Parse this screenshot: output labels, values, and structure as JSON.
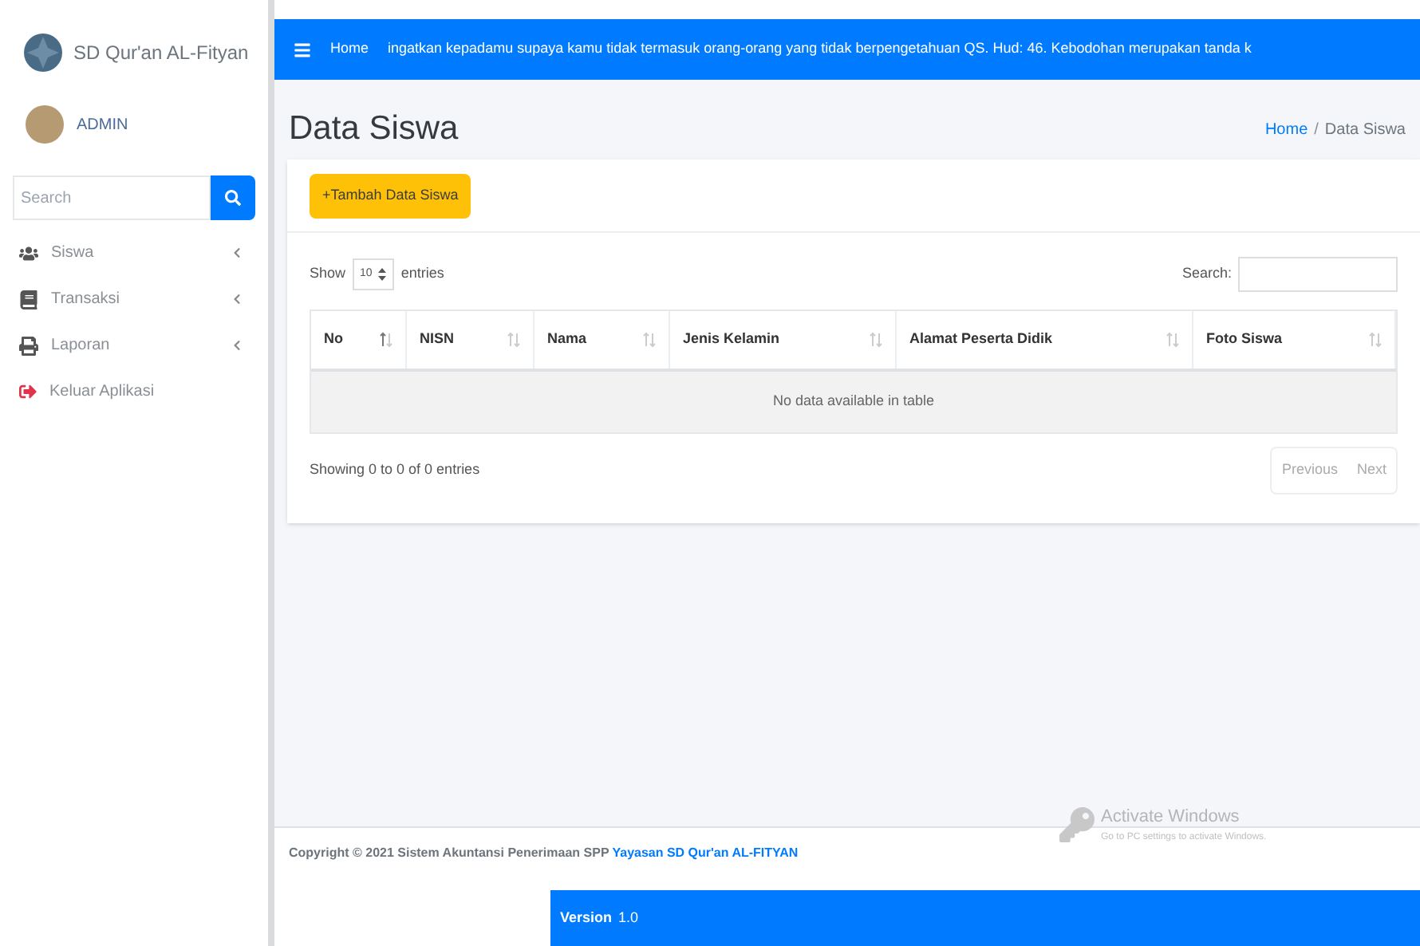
{
  "sidebar": {
    "brand": "SD Qur'an AL-Fityan",
    "user": "ADMIN",
    "search": {
      "placeholder": "Search"
    },
    "items": [
      {
        "kind": "users",
        "label": "Siswa",
        "has_caret": true
      },
      {
        "kind": "book",
        "label": "Transaksi",
        "has_caret": true
      },
      {
        "kind": "print",
        "label": "Laporan",
        "has_caret": true
      },
      {
        "kind": "logout",
        "label": "Keluar Aplikasi",
        "has_caret": false
      }
    ]
  },
  "navbar": {
    "home": "Home",
    "marquee": "ingatkan kepadamu supaya kamu tidak termasuk orang-orang yang tidak berpengetahuan QS. Hud: 46. Kebodohan merupakan tanda k"
  },
  "page": {
    "title": "Data Siswa",
    "breadcrumb_separator": "/",
    "breadcrumb": [
      {
        "label": "Home",
        "selected": false
      },
      {
        "label": "Data Siswa",
        "selected": true
      }
    ]
  },
  "card": {
    "add_button": "+Tambah Data Siswa",
    "show_label": "Show",
    "page_size": "10",
    "entries_label": "entries",
    "search_label": "Search:",
    "table": {
      "columns": [
        {
          "label": "No",
          "sorted": true
        },
        {
          "label": "NISN",
          "sorted": false
        },
        {
          "label": "Nama",
          "sorted": false
        },
        {
          "label": "Jenis Kelamin",
          "sorted": false
        },
        {
          "label": "Alamat Peserta Didik",
          "sorted": false
        },
        {
          "label": "Foto Siswa",
          "sorted": false
        }
      ],
      "empty": "No data available in table"
    },
    "info": "Showing 0 to 0 of 0 entries",
    "pagination": [
      "Previous",
      "Next"
    ]
  },
  "footer": {
    "copyright": "Copyright © 2021 Sistem Akuntansi Penerimaan SPP",
    "link": "Yayasan SD Qur'an AL-FITYAN",
    "version_label": "Version",
    "version": "1.0"
  },
  "activation": {
    "title": "Activate Windows",
    "subtitle": "Go to PC settings to activate Windows."
  }
}
